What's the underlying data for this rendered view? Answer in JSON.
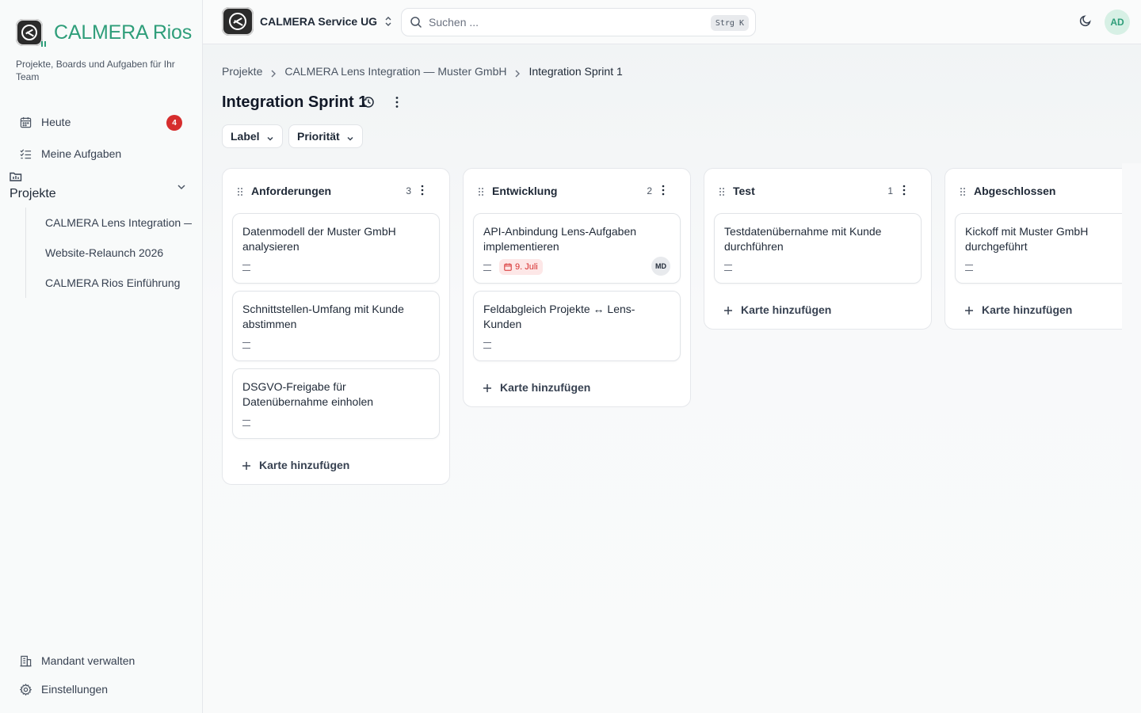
{
  "brand": {
    "name": "CALMERA Rios",
    "tagline": "Projekte, Boards und Aufgaben für Ihr Team"
  },
  "sidebar": {
    "nav": [
      {
        "label": "Heute",
        "badge": "4",
        "icon": "calendar-icon"
      },
      {
        "label": "Meine Aufgaben",
        "icon": "list-check-icon"
      }
    ],
    "projects_label": "Projekte",
    "projects": [
      "CALMERA Lens Integration — Muster GmbH",
      "Website-Relaunch 2026",
      "CALMERA Rios Einführung"
    ],
    "footer": [
      {
        "label": "Mandant verwalten",
        "icon": "building-icon"
      },
      {
        "label": "Einstellungen",
        "icon": "gear-icon"
      }
    ]
  },
  "topbar": {
    "tenant": "CALMERA Service UG",
    "search_placeholder": "Suchen ...",
    "shortcut": "Strg K",
    "avatar": "AD"
  },
  "page": {
    "breadcrumb": [
      "Projekte",
      "CALMERA Lens Integration — Muster GmbH",
      "Integration Sprint 1"
    ],
    "title": "Integration Sprint 1",
    "filters": [
      "Label",
      "Priorität"
    ]
  },
  "board": {
    "add_card_label": "Karte hinzufügen",
    "columns": [
      {
        "title": "Anforderungen",
        "count": "3",
        "cards": [
          {
            "title": "Datenmodell der Muster GmbH analysieren"
          },
          {
            "title": "Schnittstellen-Umfang mit Kunde abstimmen"
          },
          {
            "title": "DSGVO-Freigabe für Datenübernahme einholen"
          }
        ]
      },
      {
        "title": "Entwicklung",
        "count": "2",
        "cards": [
          {
            "title": "API-Anbindung Lens-Aufgaben implementieren",
            "due": "9. Juli",
            "assignee": "MD"
          },
          {
            "title": "Feldabgleich Projekte ↔ Lens-Kunden"
          }
        ]
      },
      {
        "title": "Test",
        "count": "1",
        "cards": [
          {
            "title": "Testdatenübernahme mit Kunde durchführen"
          }
        ]
      },
      {
        "title": "Abgeschlossen",
        "count": "",
        "cards": [
          {
            "title": "Kickoff mit Muster GmbH durchgeführt"
          }
        ]
      }
    ]
  },
  "colors": {
    "brand_green": "#2f9e7a",
    "badge_red": "#d62d2d",
    "due_bg": "#fde7e7"
  }
}
